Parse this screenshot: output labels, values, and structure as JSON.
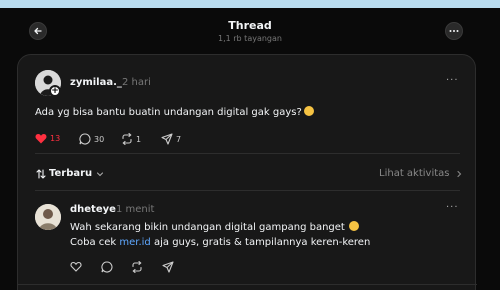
{
  "header": {
    "title": "Thread",
    "subtitle": "1,1 rb tayangan"
  },
  "post": {
    "username": "zymilaa._",
    "time": "2 hari",
    "text": "Ada yg bisa bantu buatin undangan digital gak gays?",
    "likes": "13",
    "comments": "30",
    "reposts": "1",
    "shares": "7"
  },
  "sort": {
    "label": "Terbaru",
    "activity_label": "Lihat aktivitas"
  },
  "reply": {
    "username": "dheteye",
    "time": "1 menit",
    "line1": "Wah sekarang bikin undangan digital gampang banget",
    "line2_prefix": "Coba cek",
    "link": "mer.id",
    "line2_suffix": "aja guys, gratis & tampilannya keren-keren"
  },
  "colors": {
    "like": "#ff3040",
    "link": "#5fa8ff",
    "card_bg": "#181818",
    "page_bg": "#0a0a0a"
  }
}
